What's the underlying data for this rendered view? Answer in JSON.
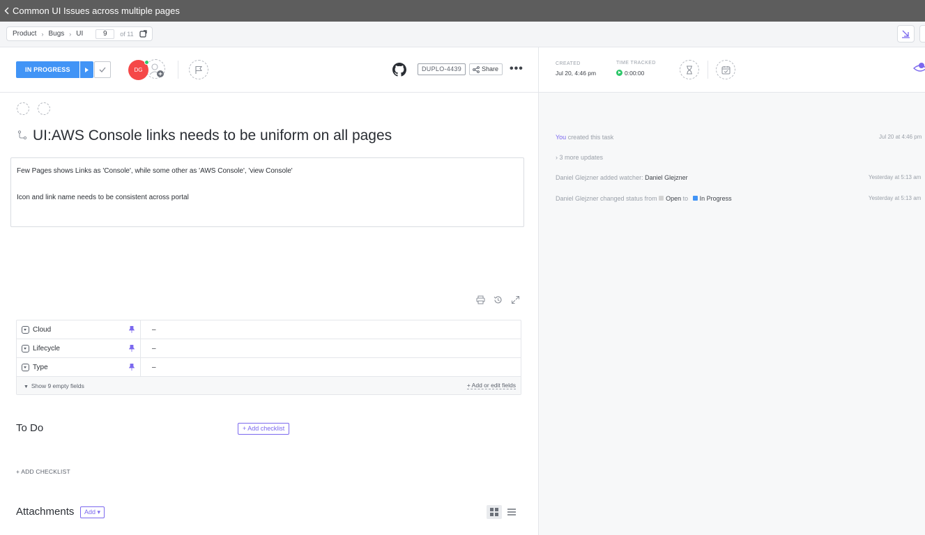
{
  "window": {
    "title": "Common UI Issues across multiple pages"
  },
  "breadcrumb": {
    "items": [
      "Product",
      "Bugs",
      "UI"
    ],
    "task_index": "9",
    "task_total": "of 11"
  },
  "header": {
    "status": "IN PROGRESS",
    "assignee_initials": "DG",
    "task_id": "DUPLO-4439",
    "share_label": "Share",
    "more_label": "•••"
  },
  "meta": {
    "created_label": "CREATED",
    "created_value": "Jul 20, 4:46 pm",
    "time_label": "TIME TRACKED",
    "time_value": "0:00:00"
  },
  "task": {
    "title": "UI:AWS Console links needs to be uniform on all pages",
    "description": [
      "Few Pages shows Links as 'Console', while some other as 'AWS Console', 'view Console'",
      "Icon and link name needs to be consistent across portal"
    ]
  },
  "custom_fields": {
    "rows": [
      {
        "name": "Cloud",
        "value": "–"
      },
      {
        "name": "Lifecycle",
        "value": "–"
      },
      {
        "name": "Type",
        "value": "–"
      }
    ],
    "show_empty": "Show 9 empty fields",
    "add_edit": "+ Add or edit fields"
  },
  "checklist": {
    "heading": "To Do",
    "add_button": "+ Add checklist",
    "add_link": "+ ADD CHECKLIST"
  },
  "attachments": {
    "heading": "Attachments",
    "add_button": "Add ▾"
  },
  "activity": {
    "items": [
      {
        "actor": "You",
        "text": " created this task",
        "time": "Jul 20 at 4:46 pm"
      },
      {
        "text": "3 more updates"
      },
      {
        "text": "Daniel Glejzner added watcher: ",
        "target": "Daniel Glejzner",
        "time": "Yesterday at 5:13 am"
      },
      {
        "text": "Daniel Glejzner changed status from ",
        "from": "Open",
        "mid": " to ",
        "to": "In Progress",
        "time": "Yesterday at 5:13 am"
      }
    ]
  },
  "colors": {
    "accent": "#7b68ee",
    "status_in_progress": "#4194f6",
    "status_open": "#d3d3d3",
    "avatar": "#f54848"
  }
}
